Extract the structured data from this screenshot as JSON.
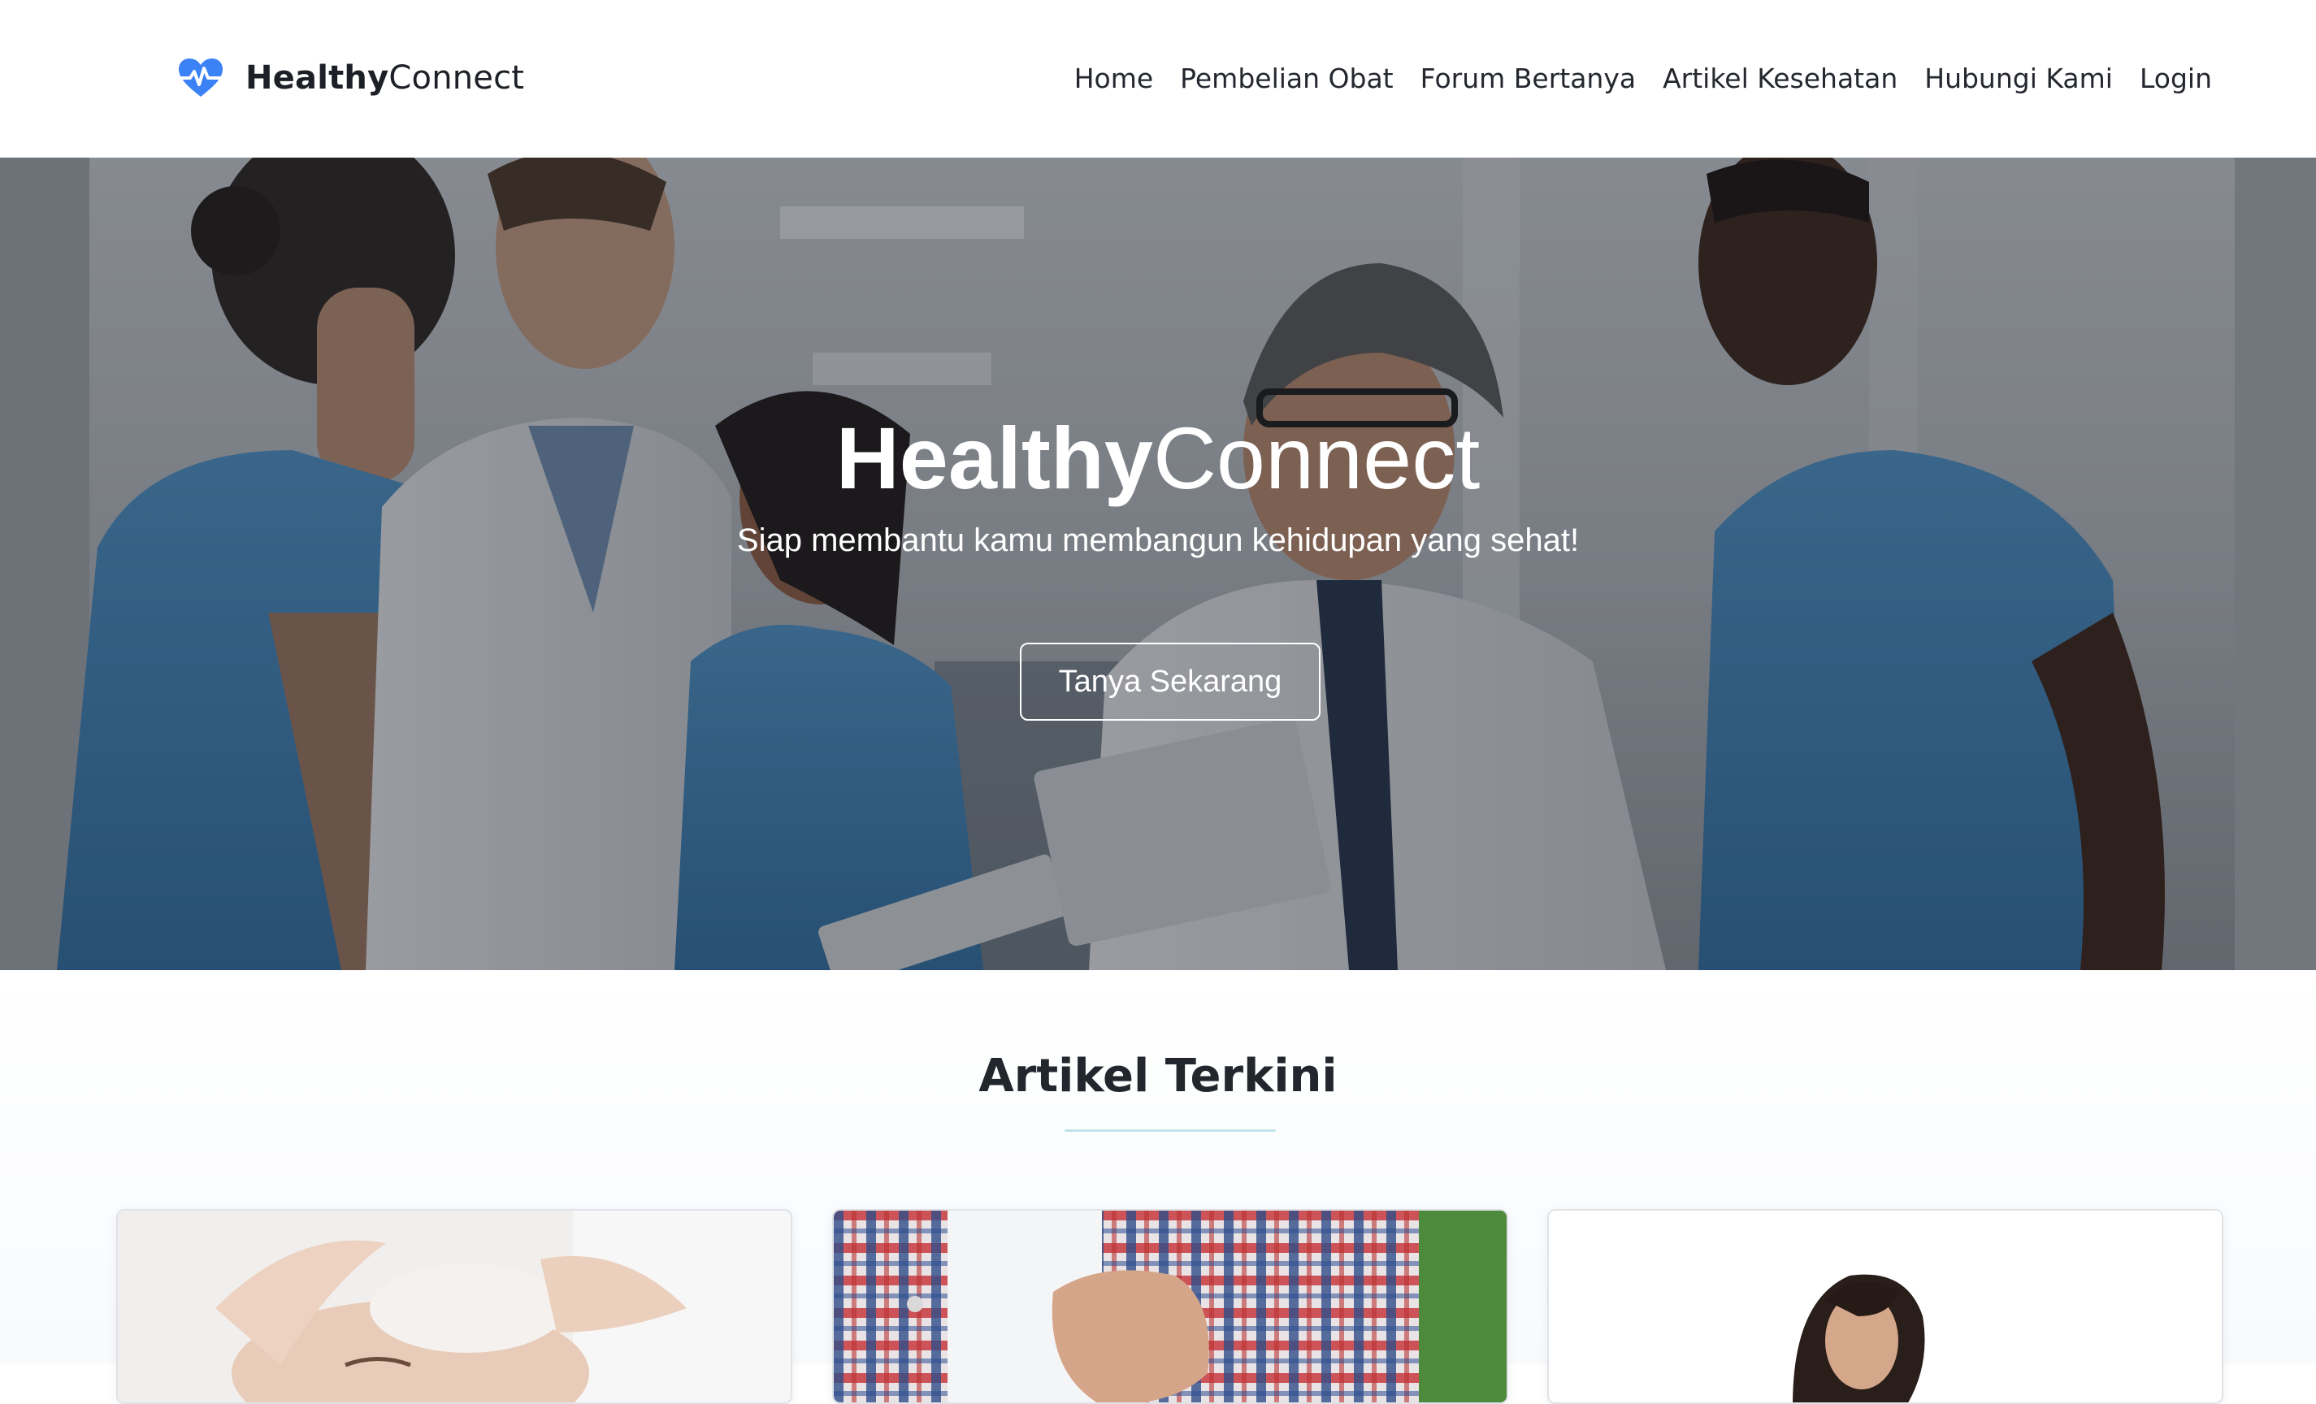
{
  "brand": {
    "icon": "heart-pulse-icon",
    "name_bold": "Healthy",
    "name_light": "Connect",
    "accent_color": "#3b82f6"
  },
  "nav": {
    "items": [
      {
        "label": "Home"
      },
      {
        "label": "Pembelian Obat"
      },
      {
        "label": "Forum Bertanya"
      },
      {
        "label": "Artikel Kesehatan"
      },
      {
        "label": "Hubungi Kami"
      },
      {
        "label": "Login"
      }
    ]
  },
  "hero": {
    "title_bold": "Healthy",
    "title_light": "Connect",
    "subtitle": "Siap membantu kamu membangun kehidupan yang sehat!",
    "cta_label": "Tanya Sekarang",
    "image": "doctors-and-nurses-conversation-photo"
  },
  "articles": {
    "title": "Artikel Terkini",
    "underline_color": "#bfe3ea",
    "cards": [
      {
        "image": "facial-treatment-photo"
      },
      {
        "image": "chest-pain-plaid-shirt-photo"
      },
      {
        "image": "woman-portrait-photo"
      }
    ]
  }
}
